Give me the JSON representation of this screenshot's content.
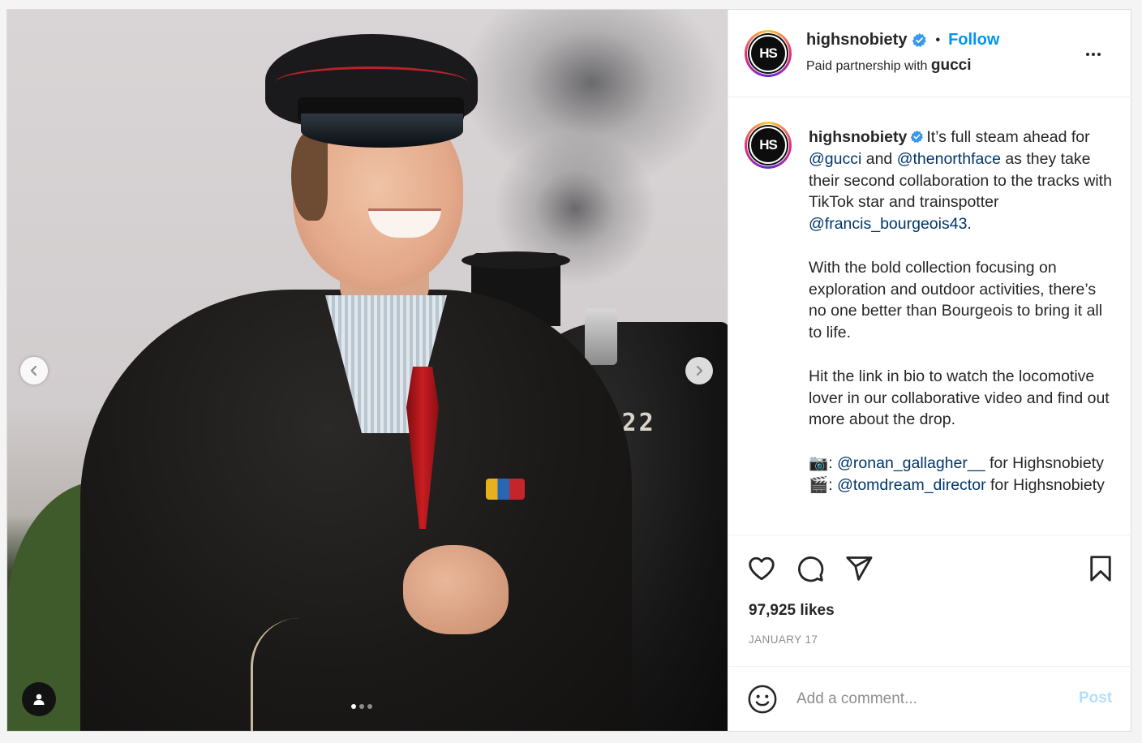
{
  "account": {
    "username": "highsnobiety",
    "logo_text": "HS",
    "verified": true,
    "follow_label": "Follow",
    "separator": "•",
    "partnership_prefix": "Paid partnership with",
    "partner": "gucci"
  },
  "media": {
    "locomotive_number": "78022",
    "carousel_dots": 3,
    "active_dot": 0,
    "icons": [
      "chevron-left-icon",
      "chevron-right-icon",
      "user-tag-icon"
    ]
  },
  "caption": {
    "username": "highsnobiety",
    "p1_text1": "It’s full steam ahead for ",
    "p1_mention1": "@gucci",
    "p1_text2": " and ",
    "p1_mention2": "@thenorthface",
    "p1_text3": " as they take their second collaboration to the tracks with TikTok star and trainspotter ",
    "p1_mention3": "@francis_bourgeois43",
    "p1_text4": ".",
    "p2": "With the bold collection focusing on exploration and outdoor activities, there’s no one better than Bourgeois to bring it all to life.",
    "p3": "Hit the link in bio to watch the locomotive lover in our collaborative video and find out more about the drop.",
    "credit1_emoji": "📷",
    "credit1_mention": "@ronan_gallagher__",
    "credit1_suffix": " for Highsnobiety",
    "credit2_emoji": "🎬",
    "credit2_mention": "@tomdream_director",
    "credit2_suffix": " for Highsnobiety",
    "colon": ": "
  },
  "actions": {
    "icons": [
      "heart-icon",
      "comment-icon",
      "share-icon",
      "bookmark-icon"
    ],
    "likes": "97,925 likes",
    "date": "JANUARY 17"
  },
  "comment": {
    "placeholder": "Add a comment...",
    "post_label": "Post"
  },
  "colors": {
    "link": "#00376b",
    "follow": "#0095f6",
    "post_disabled": "#b2dffc",
    "verified": "#3897f0"
  }
}
